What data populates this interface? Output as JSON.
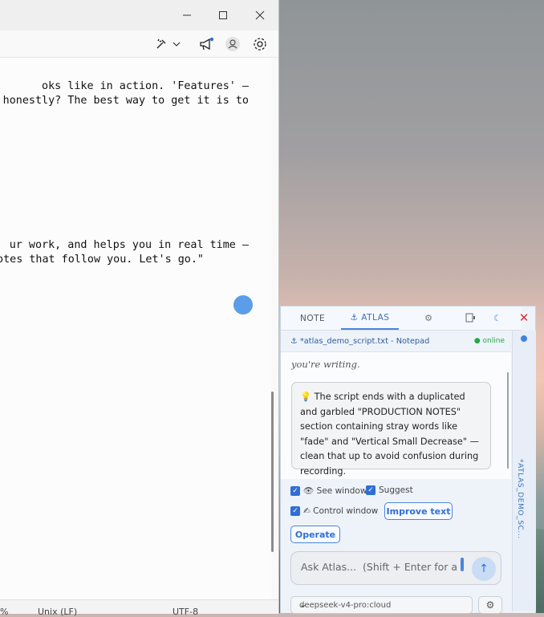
{
  "notepad": {
    "editor_lines": [
      "oks like in action. 'Features' —",
      " honestly? The best way to get it is to",
      "ur work, and helps you in real time —",
      "Notes that follow you. Let's go.\""
    ],
    "status": {
      "zoom": "%",
      "line_ending": "Unix (LF)",
      "encoding": "UTF-8"
    },
    "toolbar_icons": [
      "copilot-icon",
      "announcement-icon",
      "account-icon",
      "gear-icon"
    ]
  },
  "atlas": {
    "tabs": [
      {
        "label": "NOTE",
        "active": false
      },
      {
        "label": "⚓ ATLAS",
        "active": true
      }
    ],
    "context": {
      "window_title": "⚓ *atlas_demo_script.txt - Notepad",
      "status": "● online"
    },
    "side_label": "*ATLAS_DEMO_SC...",
    "chat": {
      "prev_tail": "you're writing.",
      "message": "💡 The script ends with a duplicated and garbled \"PRODUCTION NOTES\" section containing stray words like \"fade\" and \"Vertical Small Decrease\" — clean that up to avoid confusion during recording."
    },
    "options": {
      "see_window": "👁 See window",
      "suggest": "Suggest",
      "control_window": "✍ Control window",
      "improve_text": "Improve text",
      "operate": "Operate"
    },
    "input": {
      "placeholder": "Ask Atlas...  (Shift + Enter for a"
    },
    "model": {
      "selected": "deepseek-v4-pro:cloud"
    },
    "colors": {
      "accent": "#4a86d6",
      "online": "#27a745",
      "close": "#d8323a"
    }
  }
}
